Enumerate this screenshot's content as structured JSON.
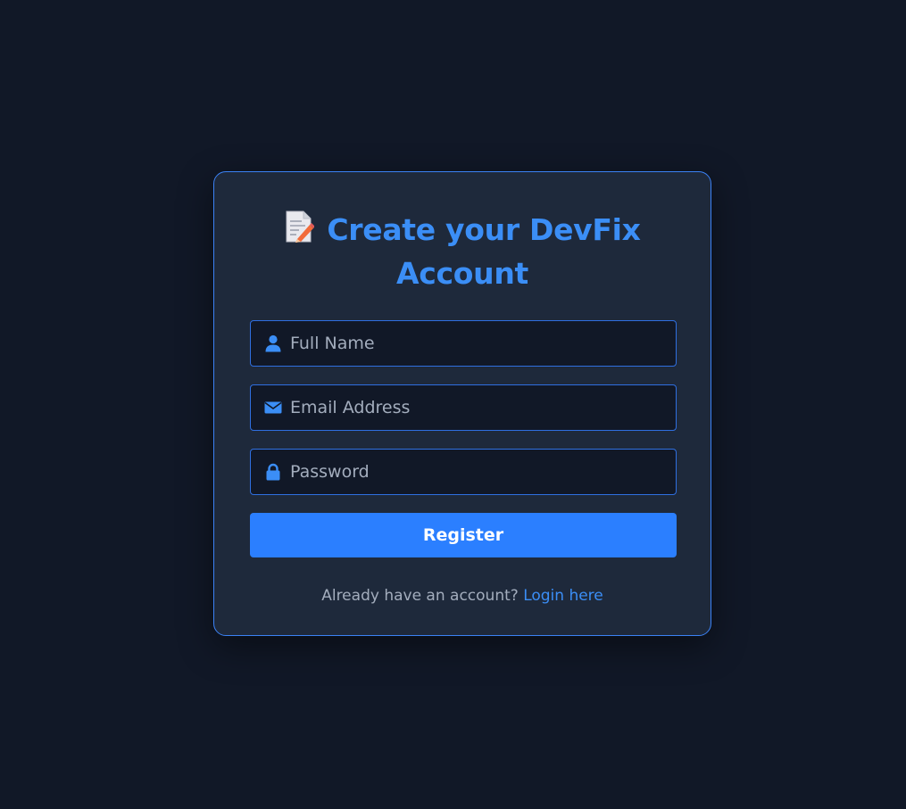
{
  "form": {
    "title": "Create your DevFix Account",
    "title_icon": "memo-icon",
    "fields": [
      {
        "name": "full-name",
        "placeholder": "Full Name",
        "value": "",
        "icon": "user-icon"
      },
      {
        "name": "email",
        "placeholder": "Email Address",
        "value": "",
        "icon": "envelope-icon"
      },
      {
        "name": "password",
        "placeholder": "Password",
        "value": "",
        "icon": "lock-icon"
      }
    ],
    "submit_label": "Register",
    "footer_text": "Already have an account?",
    "login_link": "Login here"
  },
  "colors": {
    "background": "#111827",
    "card": "#1e293b",
    "accent": "#3b8ef6",
    "button": "#2b7fff",
    "border": "#3b82f6"
  }
}
